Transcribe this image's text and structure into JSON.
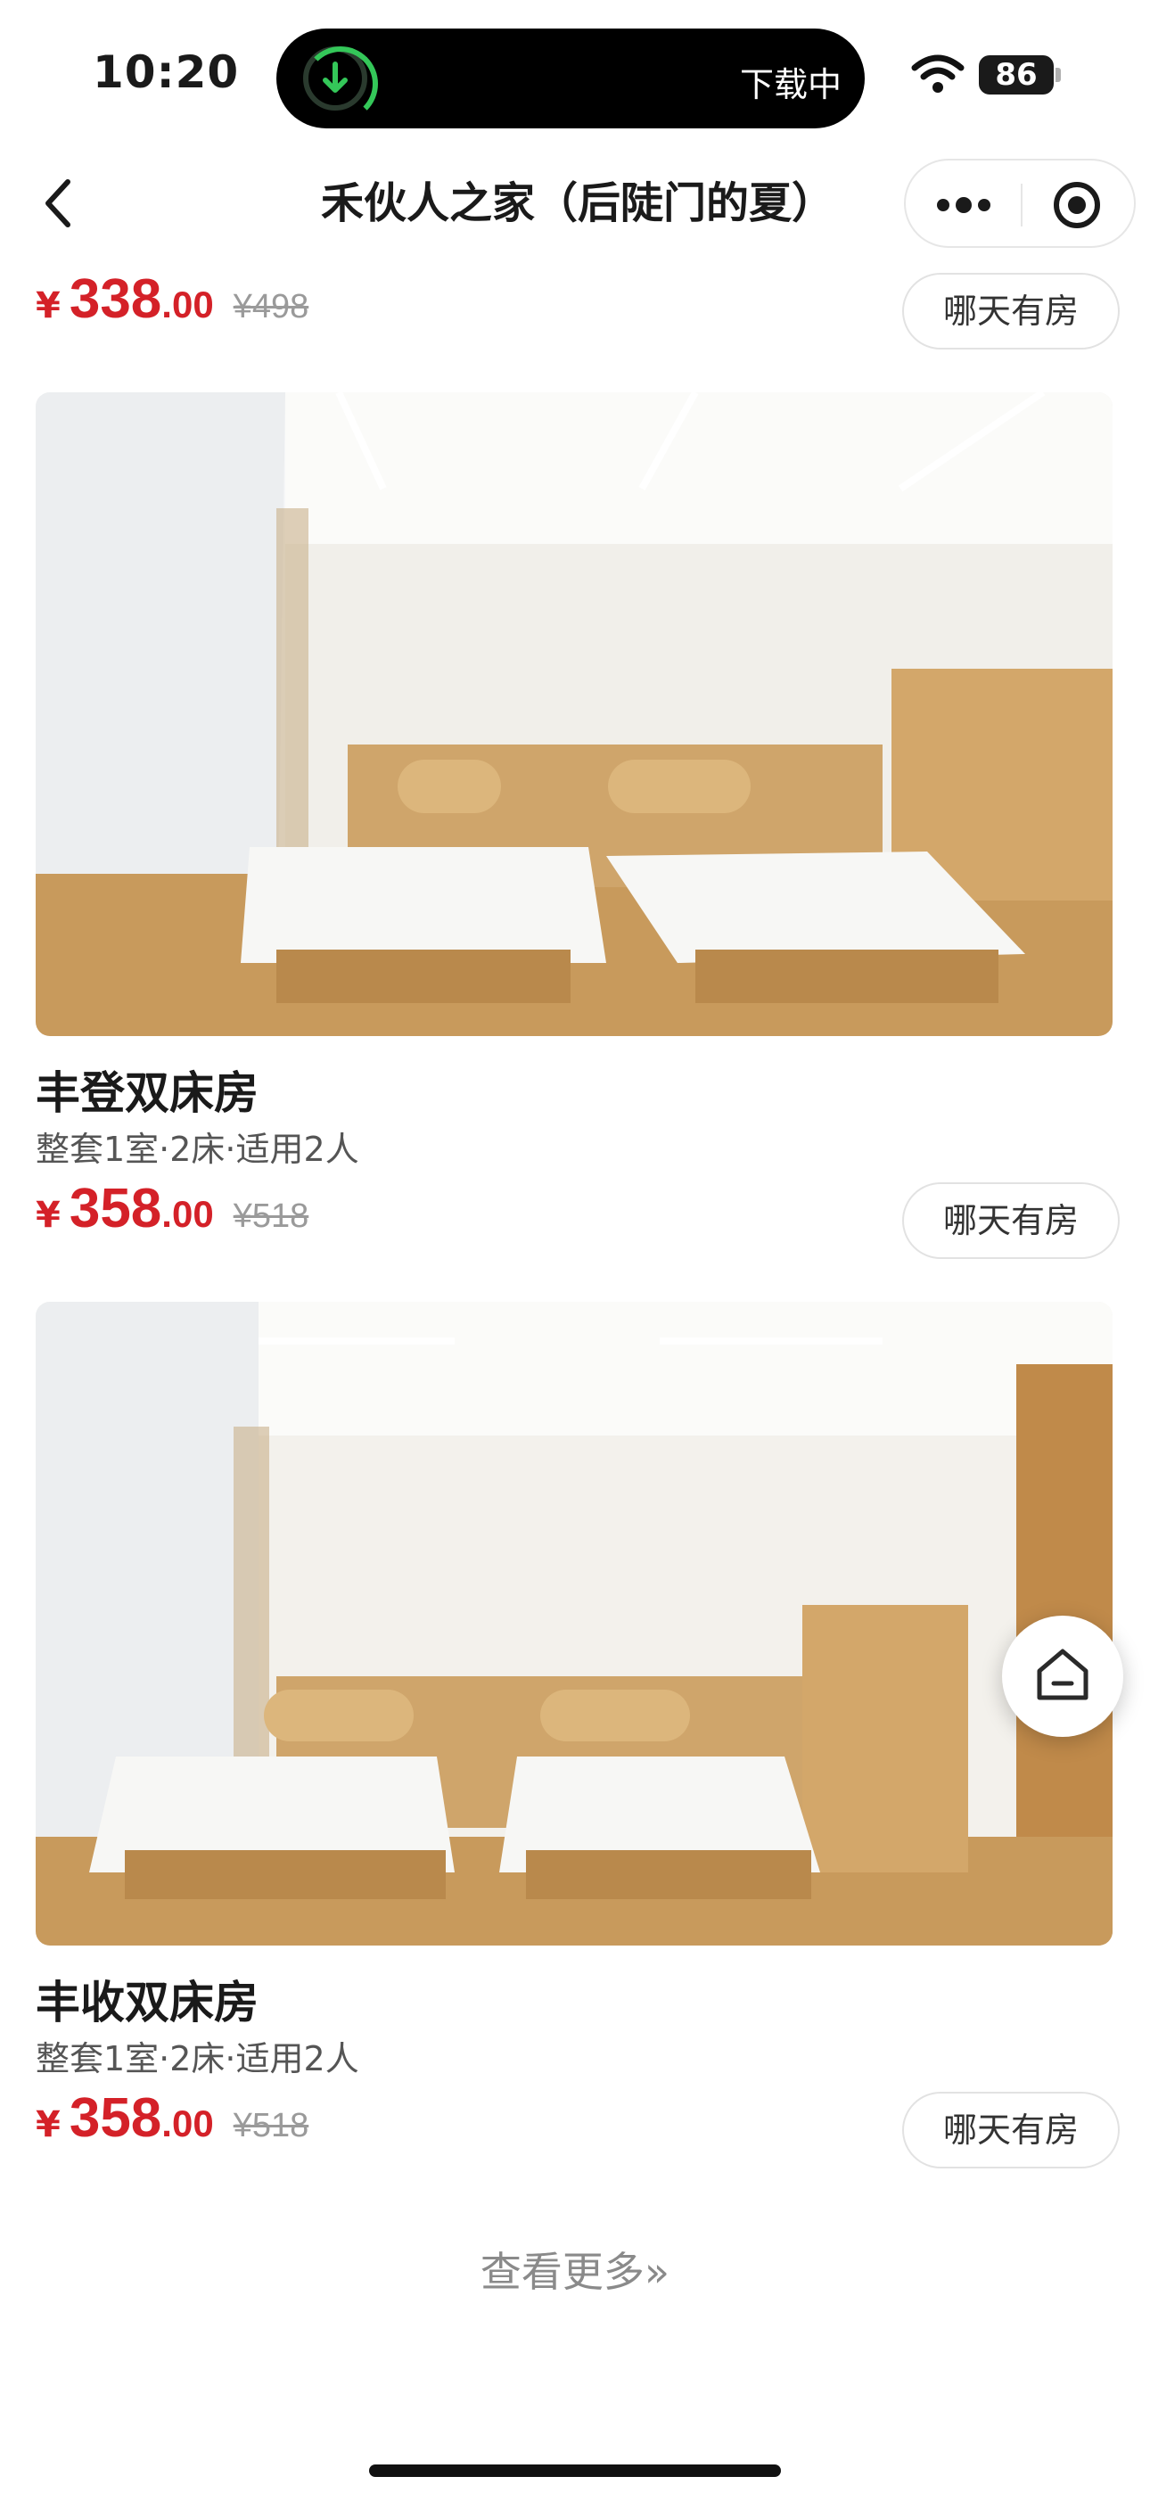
{
  "status_bar": {
    "time": "10:20",
    "island_text": "下载中",
    "battery": "86"
  },
  "nav": {
    "title": "禾伙人之家（后陡门的夏）"
  },
  "currency": "¥",
  "availability_label": "哪天有房",
  "rooms": [
    {
      "price_int": "338",
      "price_dec": ".00",
      "original_price": "¥498"
    },
    {
      "name": "丰登双床房",
      "desc": "整套1室·2床·适用2人",
      "price_int": "358",
      "price_dec": ".00",
      "original_price": "¥518"
    },
    {
      "name": "丰收双床房",
      "desc": "整套1室·2床·适用2人",
      "price_int": "358",
      "price_dec": ".00",
      "original_price": "¥518"
    }
  ],
  "see_more": "查看更多»",
  "colors": {
    "price": "#d42128",
    "wood": "#c89a5c",
    "wall": "#f3f1ec"
  }
}
